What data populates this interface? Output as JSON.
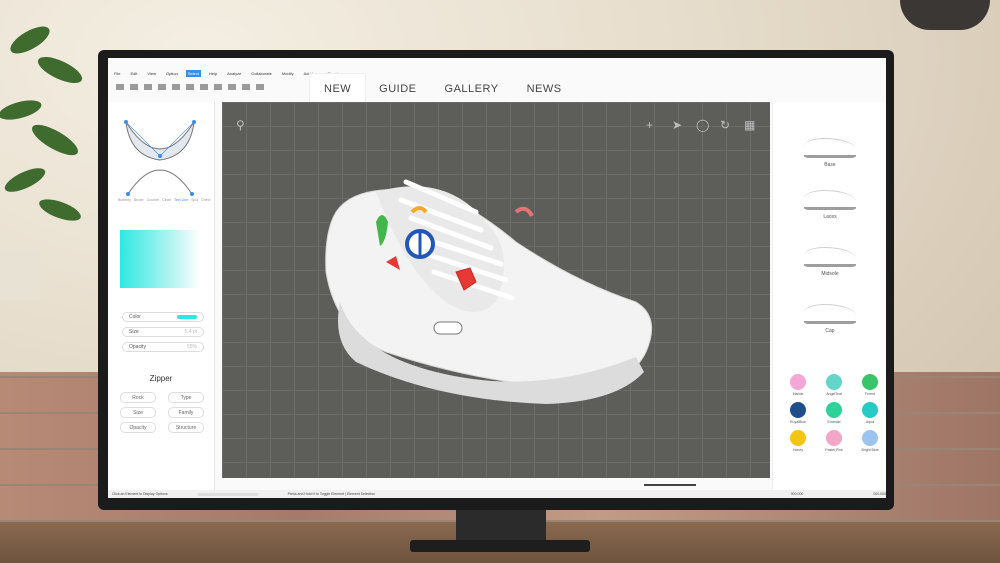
{
  "menu": [
    "File",
    "Edit",
    "View",
    "Option",
    "Select",
    "Help",
    "Analyze",
    "Collaborate",
    "Modify",
    "Add-Ins",
    "Structure"
  ],
  "menu_selected": "Select",
  "nav_tabs": [
    {
      "label": "NEW",
      "active": true
    },
    {
      "label": "GUIDE",
      "active": false
    },
    {
      "label": "GALLERY",
      "active": false
    },
    {
      "label": "NEWS",
      "active": false
    }
  ],
  "left_panel": {
    "mini_tabs": [
      "Butterfly",
      "Bezier",
      "Counter",
      "Circle",
      "Text Line",
      "Spot",
      "Direct"
    ],
    "active_mini_tab": "Text Line",
    "props": [
      {
        "label": "Color",
        "value": ""
      },
      {
        "label": "Size",
        "value": "5.4 pt"
      },
      {
        "label": "Opacity",
        "value": "55%"
      }
    ],
    "section_title": "Zipper",
    "pills": [
      "Rock",
      "Type",
      "Size",
      "Family",
      "Opacity",
      "Structure"
    ]
  },
  "right_panel": {
    "parts": [
      "Base",
      "Laces",
      "Midsole",
      "Cap"
    ],
    "colors": [
      {
        "name": "Marble",
        "color": "#f3a7d6"
      },
      {
        "name": "AngelTeal",
        "color": "#63d6c9"
      },
      {
        "name": "Forest",
        "color": "#37c46a"
      },
      {
        "name": "RoyalBlue",
        "color": "#1f4f8a"
      },
      {
        "name": "Emerald",
        "color": "#2ed39a"
      },
      {
        "name": "Aqua",
        "color": "#26cbc4"
      },
      {
        "name": "Honey",
        "color": "#f3c615"
      },
      {
        "name": "Pastel Pink",
        "color": "#f3a7c8"
      },
      {
        "name": "Bright Blue",
        "color": "#9cc4ef"
      }
    ]
  },
  "status": {
    "left": "Click an Element to Display Options",
    "middle": "Press and Hold H to Toggle Element | Element Selection",
    "right": [
      "000.000",
      "000.000"
    ]
  },
  "accent": "#3b8ce8"
}
